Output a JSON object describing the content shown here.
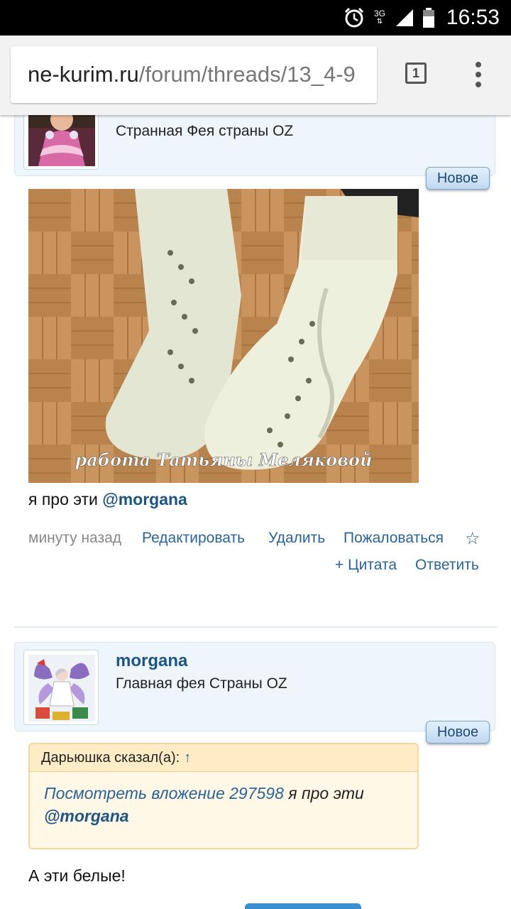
{
  "status_bar": {
    "time": "16:53",
    "network": "3G",
    "icons": [
      "alarm-icon",
      "signal-icon",
      "battery-icon"
    ]
  },
  "browser": {
    "url_host": "ne-kurim.ru",
    "url_path": "/forum/threads/13_4-9",
    "tab_count": "1"
  },
  "post1": {
    "user_title": "Странная Фея страны OZ",
    "badge": "Новое",
    "image_caption": "работа Татьяны Меляковой",
    "message_text": "я про эти ",
    "mention": "@morgana",
    "actions": {
      "time": "минуту назад",
      "edit": "Редактировать",
      "delete": "Удалить",
      "report": "Пожаловаться",
      "star": "☆",
      "quote": "+ Цитата",
      "reply": "Ответить"
    }
  },
  "post2": {
    "username": "morgana",
    "user_title": "Главная фея Страны OZ",
    "badge": "Новое",
    "quote": {
      "header": "Дарьюшка сказал(а):",
      "arrow": "↑",
      "attachment_link": "Посмотреть вложение 297598",
      "text": " я про эти ",
      "mention": "@morgana"
    },
    "message_text": "А эти белые!"
  },
  "colors": {
    "link": "#2a6496",
    "username": "#1c5584",
    "card_bg": "#eef6fc",
    "quote_bg": "#fff8e6"
  }
}
